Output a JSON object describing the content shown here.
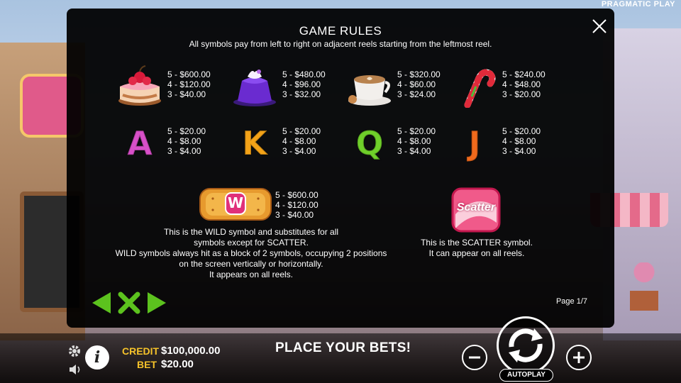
{
  "brand": "PRAGMATIC PLAY",
  "modal": {
    "title": "GAME RULES",
    "subtitle": "All symbols pay from left to right on adjacent reels starting from the leftmost reel.",
    "page": "Page 1/7"
  },
  "paytable": [
    {
      "symbol": "cake-icon",
      "pays": [
        "5 - $600.00",
        "4 - $120.00",
        "3 - $40.00"
      ]
    },
    {
      "symbol": "jelly-icon",
      "pays": [
        "5 - $480.00",
        "4 - $96.00",
        "3 - $32.00"
      ]
    },
    {
      "symbol": "coffee-icon",
      "pays": [
        "5 - $320.00",
        "4 - $60.00",
        "3 - $24.00"
      ]
    },
    {
      "symbol": "candy-cane-icon",
      "pays": [
        "5 - $240.00",
        "4 - $48.00",
        "3 - $20.00"
      ]
    },
    {
      "symbol": "A",
      "color": "#d84fc8",
      "pays": [
        "5 - $20.00",
        "4 - $8.00",
        "3 - $4.00"
      ]
    },
    {
      "symbol": "K",
      "color": "#f4a318",
      "pays": [
        "5 - $20.00",
        "4 - $8.00",
        "3 - $4.00"
      ]
    },
    {
      "symbol": "Q",
      "color": "#6fcf2a",
      "pays": [
        "5 - $20.00",
        "4 - $8.00",
        "3 - $4.00"
      ]
    },
    {
      "symbol": "J",
      "color": "#f06a1c",
      "pays": [
        "5 - $20.00",
        "4 - $8.00",
        "3 - $4.00"
      ]
    }
  ],
  "wild": {
    "label": "W",
    "pays": [
      "5 - $600.00",
      "4 - $120.00",
      "3 - $40.00"
    ],
    "desc": [
      "This is the WILD symbol and substitutes for all",
      "symbols except for SCATTER.",
      "WILD symbols always hit as a block of 2 symbols, occupying 2 positions",
      "on the screen vertically or horizontally.",
      "It appears on all reels."
    ]
  },
  "scatter": {
    "label": "Scatter",
    "desc": [
      "This is the SCATTER symbol.",
      "It can appear on all reels."
    ]
  },
  "footer": {
    "credit_label": "CREDIT",
    "credit_value": "$100,000.00",
    "bet_label": "BET",
    "bet_value": "$20.00",
    "message": "PLACE YOUR BETS!",
    "autoplay": "AUTOPLAY",
    "info": "i"
  },
  "colors": {
    "accent_green": "#5cc21e",
    "label_gold": "#f5c22a"
  }
}
